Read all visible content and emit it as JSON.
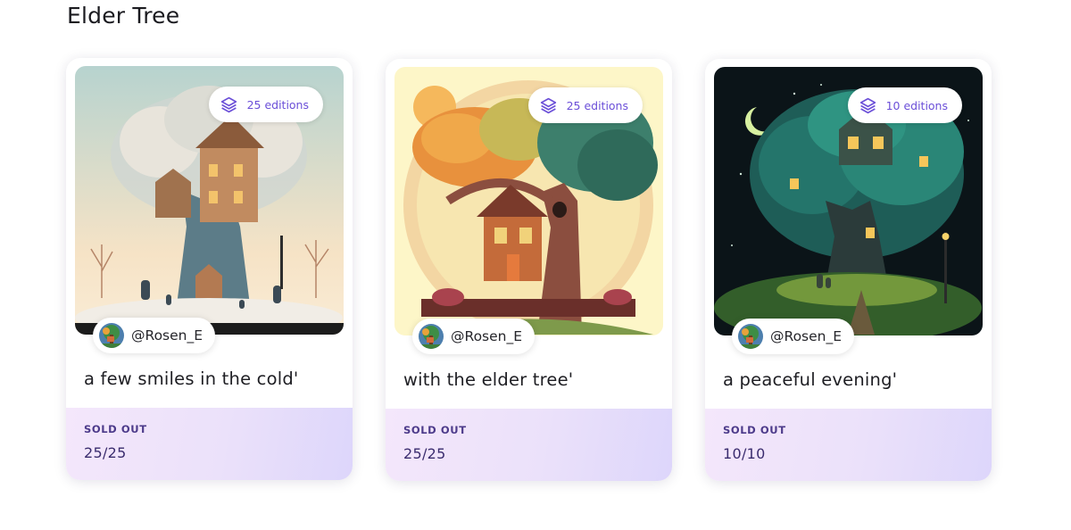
{
  "section": {
    "title": "Elder Tree"
  },
  "cards": [
    {
      "editions_label": "25 editions",
      "creator": "@Rosen_E",
      "title": "a few smiles in the cold'",
      "status": "SOLD OUT",
      "count": "25/25"
    },
    {
      "editions_label": "25 editions",
      "creator": "@Rosen_E",
      "title": "with the elder tree'",
      "status": "SOLD OUT",
      "count": "25/25"
    },
    {
      "editions_label": "10 editions",
      "creator": "@Rosen_E",
      "title": "a peaceful evening'",
      "status": "SOLD OUT",
      "count": "10/10"
    }
  ],
  "icons": {
    "editions": "layers-icon",
    "creator": "avatar"
  },
  "colors": {
    "accent": "#6b4fd8",
    "footer_gradient_start": "#f4e7fb",
    "footer_gradient_end": "#ddd6fb"
  }
}
